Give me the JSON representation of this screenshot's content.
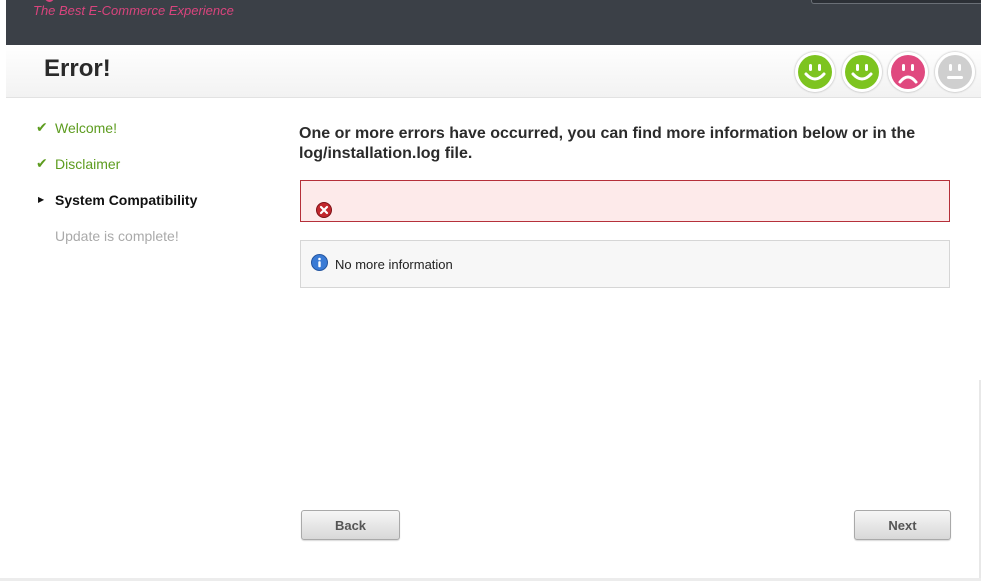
{
  "header": {
    "tagline": "The Best E-Commerce Experience",
    "title": "Error!"
  },
  "status_faces": [
    {
      "state": "happy",
      "color": "#7dc41f"
    },
    {
      "state": "happy",
      "color": "#7dc41f"
    },
    {
      "state": "sad",
      "color": "#e0497f"
    },
    {
      "state": "neutral",
      "color": "#cfcfcf"
    }
  ],
  "steps": [
    {
      "label": "Welcome!",
      "state": "done",
      "icon": "check-icon"
    },
    {
      "label": "Disclaimer",
      "state": "done",
      "icon": "check-icon"
    },
    {
      "label": "System Compatibility",
      "state": "active",
      "icon": "triangle-right-icon"
    },
    {
      "label": "Update is complete!",
      "state": "pending"
    }
  ],
  "main": {
    "heading": "One or more errors have occurred, you can find more information below or in the log/installation.log file.",
    "error_message": "",
    "info_message": "No more information"
  },
  "buttons": {
    "back": "Back",
    "next": "Next"
  },
  "colors": {
    "topbar": "#3b4047",
    "accent_pink": "#d9447d",
    "success_green": "#5d9c1f",
    "error_border": "#b5303a",
    "error_bg": "#fdeaea"
  }
}
